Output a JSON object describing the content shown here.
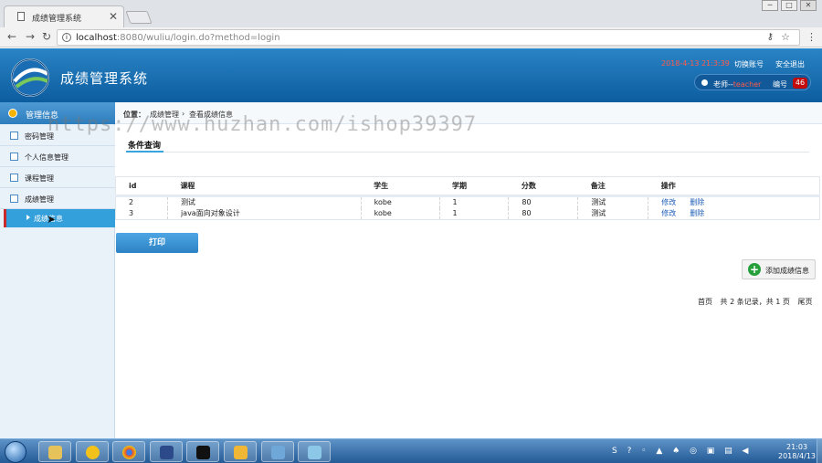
{
  "browser": {
    "tab_title": "成绩管理系统",
    "tab_close": "✕",
    "url_host": "localhost",
    "url_rest": ":8080/wuliu/login.do?method=login",
    "nav_back": "←",
    "nav_forward": "→",
    "nav_reload": "↻",
    "key_icon": "⚷",
    "star_icon": "☆",
    "menu_icon": "⋮",
    "win_min": "─",
    "win_max": "□",
    "win_close": "✕"
  },
  "header": {
    "title": "成绩管理系统",
    "datetime": "2018-4-13 21:3:39",
    "switch_account": "切换账号",
    "logout": "安全退出",
    "user_role": "老师--",
    "user_name": "teacher",
    "id_label": "编号",
    "id_value": "46"
  },
  "sidebar": {
    "header": "管理信息",
    "items": [
      {
        "label": "密码管理"
      },
      {
        "label": "个人信息管理"
      },
      {
        "label": "课程管理"
      },
      {
        "label": "成绩管理"
      }
    ],
    "sub_item": "成绩信息"
  },
  "breadcrumb": {
    "prefix": "位置：",
    "level1": "成绩管理",
    "sep": "›",
    "level2": "查看成绩信息"
  },
  "query": {
    "tab": "条件查询"
  },
  "table": {
    "columns": [
      "id",
      "课程",
      "学生",
      "学期",
      "分数",
      "备注",
      "操作"
    ],
    "rows": [
      {
        "id": "2",
        "course": "测试",
        "student": "kobe",
        "term": "1",
        "score": "80",
        "note": "测试",
        "edit": "修改",
        "delete": "删除"
      },
      {
        "id": "3",
        "course": "java面向对象设计",
        "student": "kobe",
        "term": "1",
        "score": "80",
        "note": "测试",
        "edit": "修改",
        "delete": "删除"
      }
    ]
  },
  "actions": {
    "print": "打印",
    "add": "添加成绩信息"
  },
  "pager": {
    "first": "首页",
    "total": "共 2 条记录，共 1 页",
    "last": "尾页"
  },
  "watermark": "https://www.huzhan.com/ishop39397",
  "taskbar": {
    "time": "21:03",
    "date": "2018/4/13",
    "tray": "S ? ◦ ▲ ♠ ◎ ▣ ▤ ◀"
  },
  "colors": {
    "header_blue": "#0c5d9f",
    "accent_blue": "#34a0db",
    "alert_red": "#c30d0d",
    "link_blue": "#1f5fb6",
    "add_green": "#27a03b"
  }
}
